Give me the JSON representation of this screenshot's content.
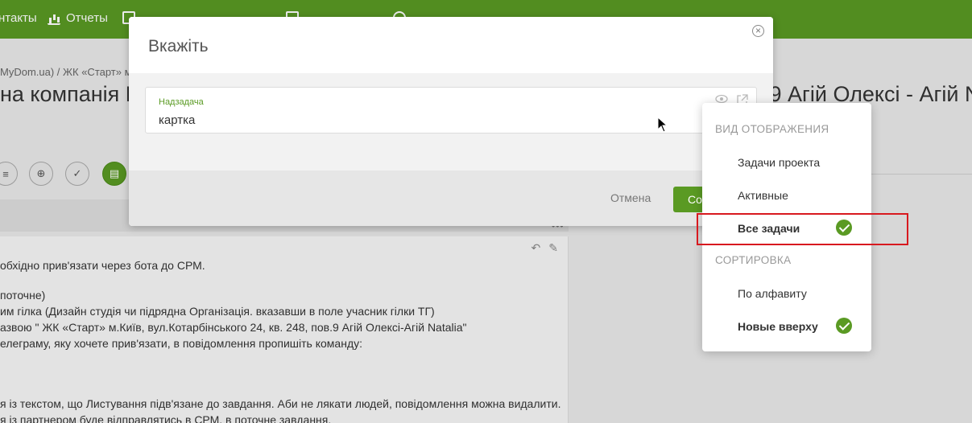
{
  "topbar": {
    "items": [
      {
        "label": "нтакты",
        "icon": "contacts-icon"
      },
      {
        "label": "Отчеты",
        "icon": "reports-icon"
      }
    ]
  },
  "page": {
    "breadcrumb": "MyDom.ua) / ЖК «Старт» м.",
    "title_left": "на компанія В",
    "title_right": ".9 Агій Олексі - Агій N",
    "message_lines": [
      "обхідно прив'язати через бота до СРМ.",
      " поточне)",
      "им гілка (Дизайн студія чи підрядна Організація. вказавши в поле учасник гілки ТГ)",
      "азвою \" ЖК «Старт» м.Київ, вул.Котарбінського 24, кв. 248, пов.9 Агій Олексі-Агій Natalia\"",
      "елеграму, яку хочете прив'язати, в повідомлення пропишіть команду:",
      "я із текстом, що Листування підв'язане до завдання. Аби не лякати людей, повідомлення можна видалити.",
      "я із партнером буде відправлятись в СРМ. в поточне завдання."
    ],
    "dots": "•••"
  },
  "modal": {
    "title": "Вкажіть",
    "field_label": "Надзадача",
    "field_value": "картка",
    "cancel_label": "Отмена",
    "save_label": "Со"
  },
  "dropdown": {
    "view_section": "ВИД ОТОБРАЖЕНИЯ",
    "view_items": [
      {
        "label": "Задачи проекта",
        "checked": false
      },
      {
        "label": "Активные",
        "checked": false
      },
      {
        "label": "Все задачи",
        "checked": true
      }
    ],
    "sort_section": "СОРТИРОВКА",
    "sort_items": [
      {
        "label": "По алфавиту",
        "checked": false
      },
      {
        "label": "Новые вверху",
        "checked": true
      }
    ]
  },
  "colors": {
    "accent": "#5a9a23",
    "highlight": "#d8191f"
  }
}
